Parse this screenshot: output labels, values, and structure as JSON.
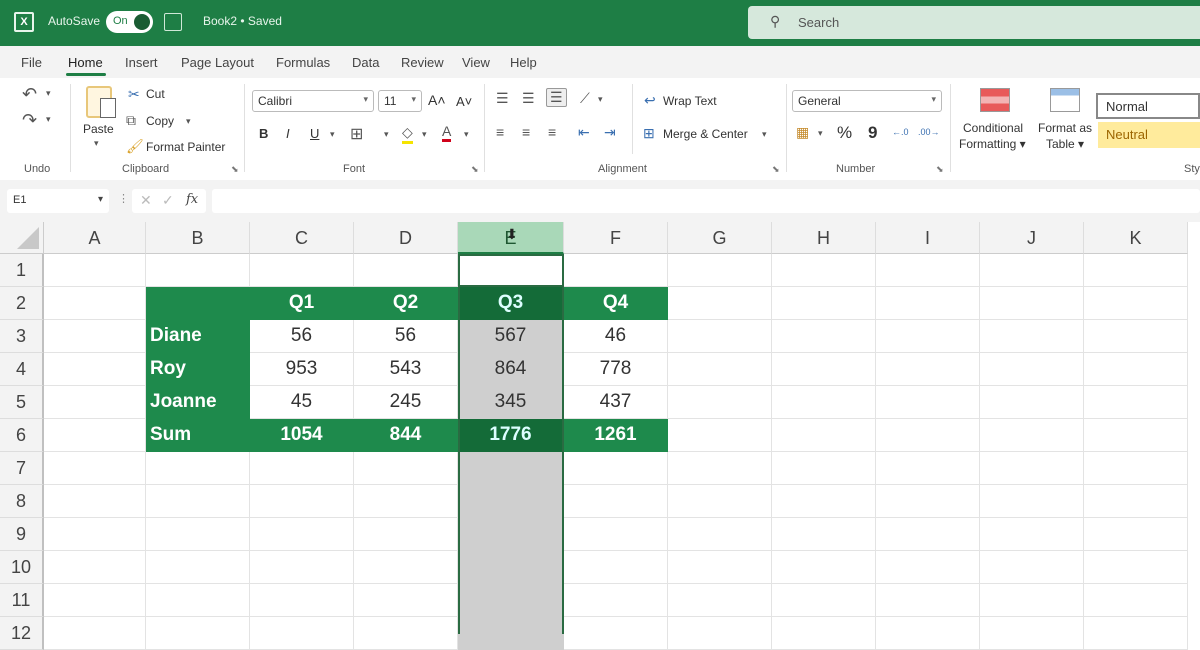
{
  "titlebar": {
    "autosave_label": "AutoSave",
    "autosave_state": "On",
    "filename": "Book2 • Saved",
    "filename_caret": "⌄",
    "search_placeholder": "Search",
    "search_icon": "⚲",
    "app_icon": "X",
    "brand_color": "#1e7e45"
  },
  "menu": {
    "items": [
      "File",
      "Home",
      "Insert",
      "Page Layout",
      "Formulas",
      "Data",
      "Review",
      "View",
      "Help"
    ],
    "active": "Home"
  },
  "ribbon": {
    "undo": {
      "undo_icon": "↶",
      "redo_icon": "↷",
      "label": "Undo"
    },
    "clipboard": {
      "paste_label": "Paste",
      "cut_label": "Cut",
      "copy_label": "Copy",
      "format_painter_label": "Format Painter",
      "label": "Clipboard"
    },
    "font": {
      "font_name": "Calibri",
      "font_size": "11",
      "grow_icon": "A˄",
      "shrink_icon": "A˅",
      "bold": "B",
      "italic": "I",
      "underline": "U",
      "borders_icon": "⊞",
      "fill_icon": "◇",
      "font_color_icon": "A",
      "label": "Font"
    },
    "alignment": {
      "wrap_text_label": "Wrap Text",
      "merge_center_label": "Merge & Center",
      "label": "Alignment"
    },
    "number": {
      "format": "General",
      "percent": "%",
      "comma": "9",
      "inc_decimal": "←.0",
      "dec_decimal": ".00→",
      "label": "Number"
    },
    "styles": {
      "conditional_formatting_label_1": "Conditional",
      "conditional_formatting_label_2": "Formatting ▾",
      "format_as_table_label_1": "Format as",
      "format_as_table_label_2": "Table ▾",
      "normal_label": "Normal",
      "neutral_label": "Neutral",
      "label": "Sty"
    },
    "caret": "▾",
    "launcher": "⬊"
  },
  "formula_bar": {
    "name_box": "E1",
    "cancel_icon": "✕",
    "enter_icon": "✓",
    "fx_label": "fx",
    "formula": ""
  },
  "sheet": {
    "columns": [
      "A",
      "B",
      "C",
      "D",
      "E",
      "F",
      "G",
      "H",
      "I",
      "J",
      "K"
    ],
    "selected_column": "E",
    "rows": [
      "1",
      "2",
      "3",
      "4",
      "5",
      "6",
      "7",
      "8",
      "9",
      "10",
      "11",
      "12"
    ],
    "table": {
      "headers": [
        "",
        "Q1",
        "Q2",
        "Q3",
        "Q4"
      ],
      "data": [
        [
          "Diane",
          "56",
          "56",
          "567",
          "46"
        ],
        [
          "Roy",
          "953",
          "543",
          "864",
          "778"
        ],
        [
          "Joanne",
          "45",
          "245",
          "345",
          "437"
        ],
        [
          "Sum",
          "1054",
          "844",
          "1776",
          "1261"
        ]
      ]
    },
    "header_green": "#1e8a4c",
    "selected_green": "#146b38"
  }
}
